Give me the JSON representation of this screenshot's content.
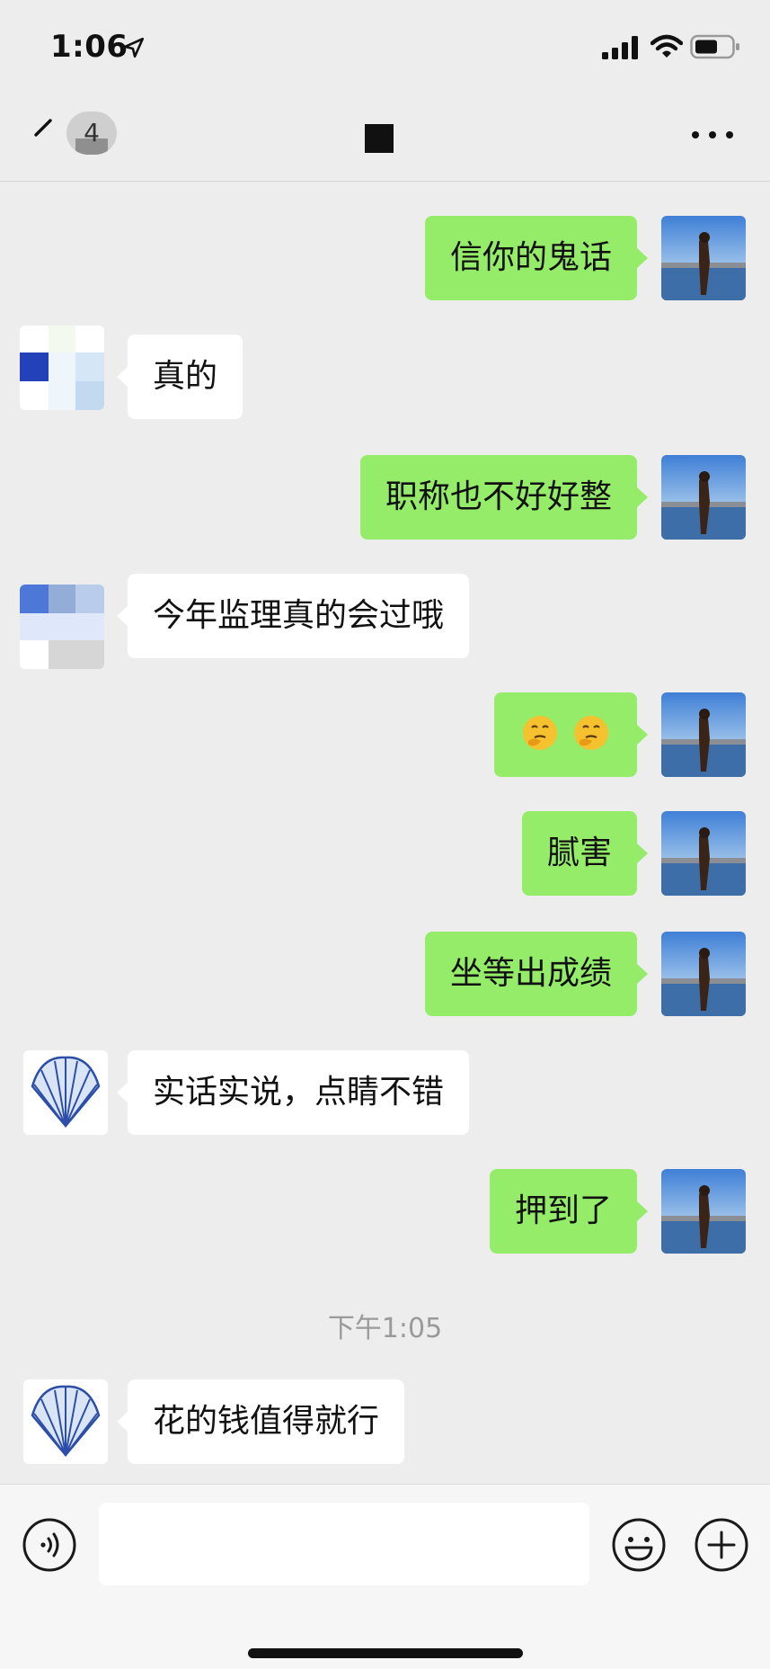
{
  "status_bar": {
    "time": "1:06",
    "icons": [
      "location-arrow-icon",
      "signal-icon",
      "wifi-icon",
      "battery-icon"
    ]
  },
  "nav": {
    "back_icon": "chevron-left-icon",
    "unread_count": "4",
    "more_icon": "more-dots-icon"
  },
  "messages": [
    {
      "side": "me",
      "text": "信你的鬼话"
    },
    {
      "side": "them",
      "text": "真的"
    },
    {
      "side": "me",
      "text": "职称也不好好整"
    },
    {
      "side": "them",
      "text": "今年监理真的会过哦"
    },
    {
      "side": "me",
      "text": "",
      "emoji": [
        "thinking-face-icon",
        "thinking-face-icon"
      ]
    },
    {
      "side": "me",
      "text": "腻害"
    },
    {
      "side": "me",
      "text": "坐等出成绩"
    },
    {
      "side": "them",
      "text": "实话实说，点睛不错"
    },
    {
      "side": "me",
      "text": "押到了"
    },
    {
      "side": "them",
      "text": "花的钱值得就行"
    }
  ],
  "timestamp": "下午1:05",
  "input_bar": {
    "voice_icon": "voice-icon",
    "emoji_icon": "smiley-icon",
    "plus_icon": "plus-icon",
    "input_value": ""
  },
  "colors": {
    "my_bubble": "#95ec69",
    "their_bubble": "#ffffff",
    "background": "#ededed"
  }
}
